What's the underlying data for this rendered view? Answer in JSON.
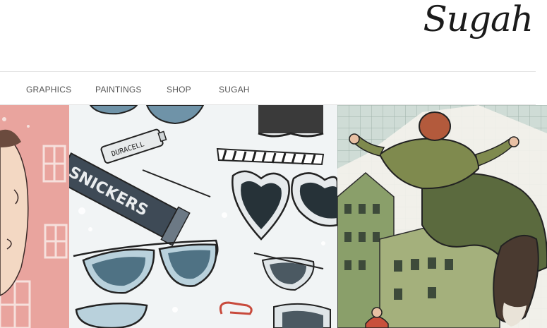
{
  "brand": {
    "logo_text": "Sugah"
  },
  "nav": {
    "items": [
      {
        "label": "GRAPHICS"
      },
      {
        "label": "PAINTINGS"
      },
      {
        "label": "SHOP"
      },
      {
        "label": "SUGAH"
      }
    ]
  },
  "gallery": {
    "items": [
      {
        "name": "illustration-portrait-pink"
      },
      {
        "name": "illustration-sunglasses-pattern"
      },
      {
        "name": "illustration-jumping-man"
      }
    ],
    "product_labels": {
      "battery_text": "DURACELL",
      "snickers_text": "SNICKERS"
    }
  },
  "colors": {
    "nav_text": "#555555",
    "divider": "#e2e2e2",
    "panel_pink": "#e9a49e",
    "panel_tiles": "#c9d6cf"
  }
}
